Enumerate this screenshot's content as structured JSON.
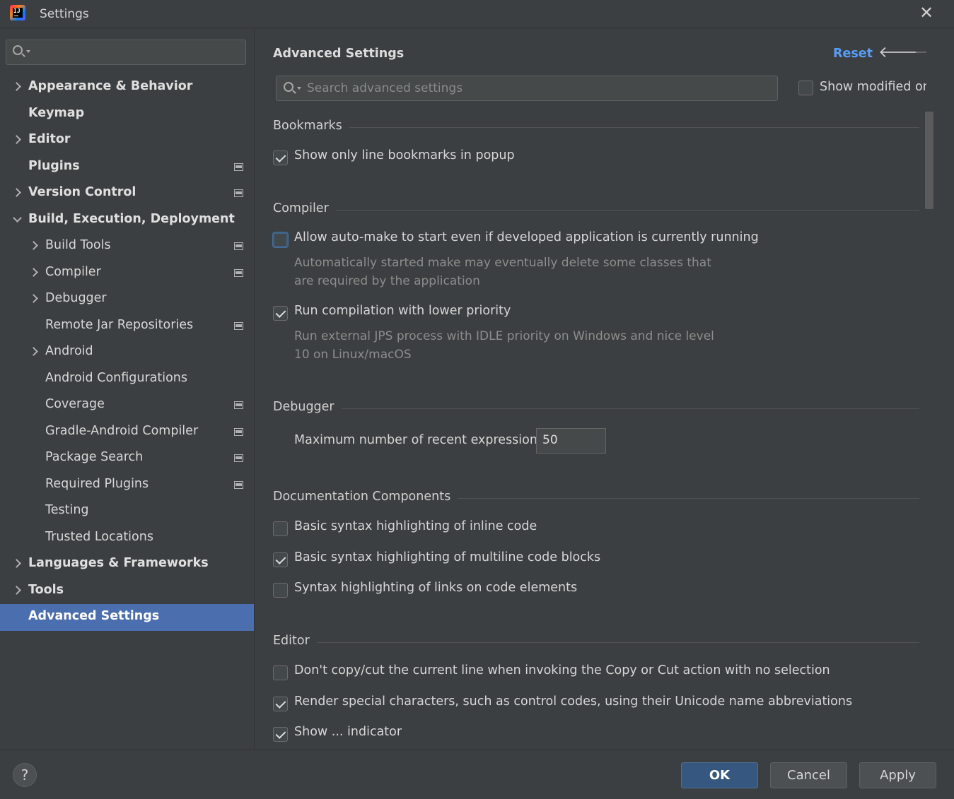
{
  "window": {
    "title": "Settings",
    "app_icon": "intellij-idea-icon",
    "close_icon": "close-icon"
  },
  "sidebar": {
    "search_placeholder": "",
    "items": [
      {
        "label": "Appearance & Behavior",
        "level": 0,
        "expander": "collapsed",
        "project_icon": false,
        "selected": false
      },
      {
        "label": "Keymap",
        "level": 0,
        "expander": "none",
        "project_icon": false,
        "selected": false
      },
      {
        "label": "Editor",
        "level": 0,
        "expander": "collapsed",
        "project_icon": false,
        "selected": false
      },
      {
        "label": "Plugins",
        "level": 0,
        "expander": "none",
        "project_icon": true,
        "selected": false
      },
      {
        "label": "Version Control",
        "level": 0,
        "expander": "collapsed",
        "project_icon": true,
        "selected": false
      },
      {
        "label": "Build, Execution, Deployment",
        "level": 0,
        "expander": "expanded",
        "project_icon": false,
        "selected": false
      },
      {
        "label": "Build Tools",
        "level": 1,
        "expander": "collapsed",
        "project_icon": true,
        "selected": false
      },
      {
        "label": "Compiler",
        "level": 1,
        "expander": "collapsed",
        "project_icon": true,
        "selected": false
      },
      {
        "label": "Debugger",
        "level": 1,
        "expander": "collapsed",
        "project_icon": false,
        "selected": false
      },
      {
        "label": "Remote Jar Repositories",
        "level": 1,
        "expander": "none",
        "project_icon": true,
        "selected": false
      },
      {
        "label": "Android",
        "level": 1,
        "expander": "collapsed",
        "project_icon": false,
        "selected": false
      },
      {
        "label": "Android Configurations",
        "level": 1,
        "expander": "none",
        "project_icon": false,
        "selected": false
      },
      {
        "label": "Coverage",
        "level": 1,
        "expander": "none",
        "project_icon": true,
        "selected": false
      },
      {
        "label": "Gradle-Android Compiler",
        "level": 1,
        "expander": "none",
        "project_icon": true,
        "selected": false
      },
      {
        "label": "Package Search",
        "level": 1,
        "expander": "none",
        "project_icon": true,
        "selected": false
      },
      {
        "label": "Required Plugins",
        "level": 1,
        "expander": "none",
        "project_icon": true,
        "selected": false
      },
      {
        "label": "Testing",
        "level": 1,
        "expander": "none",
        "project_icon": false,
        "selected": false
      },
      {
        "label": "Trusted Locations",
        "level": 1,
        "expander": "none",
        "project_icon": false,
        "selected": false
      },
      {
        "label": "Languages & Frameworks",
        "level": 0,
        "expander": "collapsed",
        "project_icon": false,
        "selected": false
      },
      {
        "label": "Tools",
        "level": 0,
        "expander": "collapsed",
        "project_icon": false,
        "selected": false
      },
      {
        "label": "Advanced Settings",
        "level": 0,
        "expander": "none",
        "project_icon": false,
        "selected": true
      }
    ]
  },
  "main": {
    "title": "Advanced Settings",
    "reset_label": "Reset",
    "back_icon": "arrow-left-icon",
    "forward_icon": "arrow-right-icon",
    "search_placeholder": "Search advanced settings",
    "search_value": "",
    "show_modified_only_label": "Show modified only",
    "show_modified_only_checked": false,
    "sections": {
      "bookmarks": {
        "title": "Bookmarks",
        "options": [
          {
            "label": "Show only line bookmarks in popup",
            "checked": true
          }
        ]
      },
      "compiler": {
        "title": "Compiler",
        "options": [
          {
            "label": "Allow auto-make to start even if developed application is currently running",
            "checked": false,
            "focused": true,
            "description_line1": "Automatically started make may eventually delete some classes that",
            "description_line2": "are required by the application"
          },
          {
            "label": "Run compilation with lower priority",
            "checked": true,
            "description_line1": "Run external JPS process with IDLE priority on Windows and nice level",
            "description_line2": "10 on Linux/macOS"
          }
        ]
      },
      "debugger": {
        "title": "Debugger",
        "recent_expressions_label": "Maximum number of recent expressions:",
        "recent_expressions_value": "50"
      },
      "documentation": {
        "title": "Documentation Components",
        "options": [
          {
            "label": "Basic syntax highlighting of inline code",
            "checked": false
          },
          {
            "label": "Basic syntax highlighting of multiline code blocks",
            "checked": true
          },
          {
            "label": "Syntax highlighting of links on code elements",
            "checked": false
          }
        ]
      },
      "editor": {
        "title": "Editor",
        "options": [
          {
            "label": "Don't copy/cut the current line when invoking the Copy or Cut action with no selection",
            "checked": false
          },
          {
            "label": "Render special characters, such as control codes, using their Unicode name abbreviations",
            "checked": true
          },
          {
            "label": "Show ... indicator",
            "checked": true
          }
        ]
      }
    }
  },
  "footer": {
    "help_label": "?",
    "ok_label": "OK",
    "cancel_label": "Cancel",
    "apply_label": "Apply"
  },
  "colors": {
    "background": "#3c3f41",
    "selection": "#4b6eaf",
    "link": "#589df6",
    "primary_button": "#365880",
    "description_text": "#8c8c8c"
  }
}
